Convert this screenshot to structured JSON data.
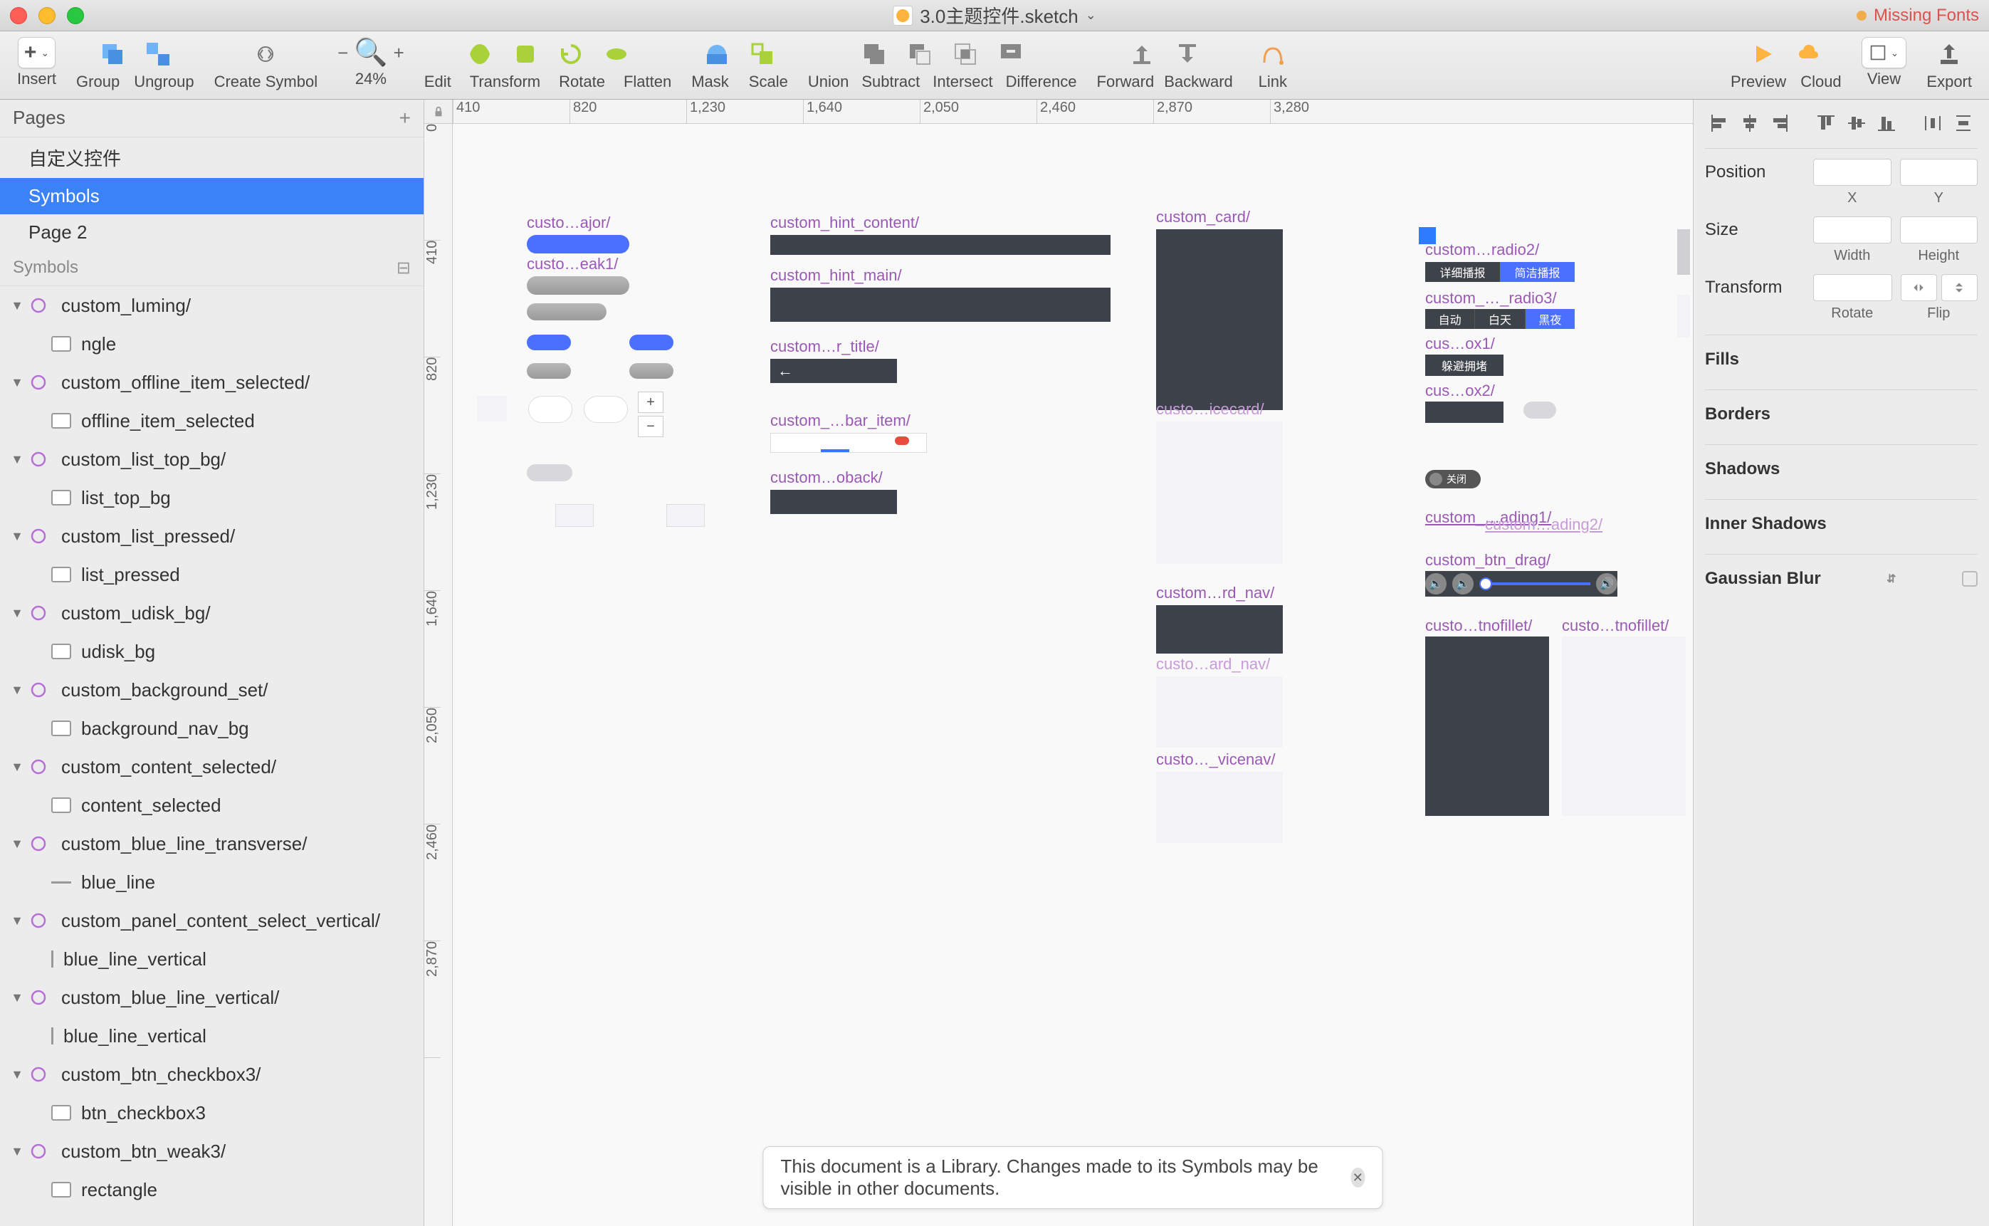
{
  "title": "3.0主题控件.sketch",
  "missing_fonts": "Missing Fonts",
  "toolbar": {
    "insert": "Insert",
    "group": "Group",
    "ungroup": "Ungroup",
    "create_symbol": "Create Symbol",
    "zoom": "24%",
    "edit": "Edit",
    "transform": "Transform",
    "rotate": "Rotate",
    "flatten": "Flatten",
    "mask": "Mask",
    "scale": "Scale",
    "union": "Union",
    "subtract": "Subtract",
    "intersect": "Intersect",
    "difference": "Difference",
    "forward": "Forward",
    "backward": "Backward",
    "link": "Link",
    "preview": "Preview",
    "cloud": "Cloud",
    "view": "View",
    "export": "Export"
  },
  "pages_header": "Pages",
  "pages": [
    "自定义控件",
    "Symbols",
    "Page 2"
  ],
  "symbols_header": "Symbols",
  "layers": [
    {
      "name": "custom_luming/",
      "type": "symbol",
      "level": 1,
      "expanded": true
    },
    {
      "name": "ngle",
      "type": "rect",
      "level": 2
    },
    {
      "name": "custom_offline_item_selected/",
      "type": "symbol",
      "level": 1,
      "expanded": true
    },
    {
      "name": "offline_item_selected",
      "type": "rect",
      "level": 2
    },
    {
      "name": "custom_list_top_bg/",
      "type": "symbol",
      "level": 1,
      "expanded": true
    },
    {
      "name": "list_top_bg",
      "type": "rect",
      "level": 2
    },
    {
      "name": "custom_list_pressed/",
      "type": "symbol",
      "level": 1,
      "expanded": true
    },
    {
      "name": "list_pressed",
      "type": "rect",
      "level": 2
    },
    {
      "name": "custom_udisk_bg/",
      "type": "symbol",
      "level": 1,
      "expanded": true
    },
    {
      "name": "udisk_bg",
      "type": "rect",
      "level": 2
    },
    {
      "name": "custom_background_set/",
      "type": "symbol",
      "level": 1,
      "expanded": true
    },
    {
      "name": "background_nav_bg",
      "type": "rect",
      "level": 2
    },
    {
      "name": "custom_content_selected/",
      "type": "symbol",
      "level": 1,
      "expanded": true
    },
    {
      "name": "content_selected",
      "type": "rect",
      "level": 2
    },
    {
      "name": "custom_blue_line_transverse/",
      "type": "symbol",
      "level": 1,
      "expanded": true
    },
    {
      "name": "blue_line",
      "type": "line",
      "level": 2
    },
    {
      "name": "custom_panel_content_select_vertical/",
      "type": "symbol",
      "level": 1,
      "expanded": true
    },
    {
      "name": "blue_line_vertical",
      "type": "vline",
      "level": 2
    },
    {
      "name": "custom_blue_line_vertical/",
      "type": "symbol",
      "level": 1,
      "expanded": true
    },
    {
      "name": "blue_line_vertical",
      "type": "vline",
      "level": 2
    },
    {
      "name": "custom_btn_checkbox3/",
      "type": "symbol",
      "level": 1,
      "expanded": true
    },
    {
      "name": "btn_checkbox3",
      "type": "rect",
      "level": 2
    },
    {
      "name": "custom_btn_weak3/",
      "type": "symbol",
      "level": 1,
      "expanded": true
    },
    {
      "name": "rectangle",
      "type": "rect",
      "level": 2
    }
  ],
  "ruler_h": [
    "410",
    "820",
    "1,230",
    "1,640",
    "2,050",
    "2,460",
    "2,870",
    "3,280"
  ],
  "ruler_v": [
    "0",
    "410",
    "820",
    "1,230",
    "1,640",
    "2,050",
    "2,460",
    "2,870"
  ],
  "artboards": {
    "major": "custo…ajor/",
    "eak1": "custo…eak1/",
    "hint_content": "custom_hint_content/",
    "hint_main": "custom_hint_main/",
    "r_title": "custom…r_title/",
    "bar_item": "custom_…bar_item/",
    "oback": "custom…oback/",
    "card": "custom_card/",
    "icecard": "custo…icecard/",
    "rd_nav": "custom…rd_nav/",
    "ard_nav": "custo…ard_nav/",
    "vicenav": "custo…_vicenav/",
    "radio2": "custom…radio2/",
    "radio3": "custom_…_radio3/",
    "ox1": "cus…ox1/",
    "ox2": "cus…ox2/",
    "ading1": "custom_…ading1/",
    "ading2": "custom…ading2/",
    "btn_drag": "custom_btn_drag/",
    "tnofillet1": "custo…tnofillet/",
    "tnofillet2": "custo…tnofillet/",
    "radio2_a": "详细播报",
    "radio2_b": "简洁播报",
    "radio3_a": "自动",
    "radio3_b": "白天",
    "radio3_c": "黑夜",
    "ox1_text": "躲避拥堵",
    "switch_text": "关闭"
  },
  "inspector": {
    "position": "Position",
    "x": "X",
    "y": "Y",
    "size": "Size",
    "width": "Width",
    "height": "Height",
    "transform": "Transform",
    "rotate": "Rotate",
    "flip": "Flip",
    "fills": "Fills",
    "borders": "Borders",
    "shadows": "Shadows",
    "inner_shadows": "Inner Shadows",
    "gaussian_blur": "Gaussian Blur"
  },
  "banner": "This document is a Library. Changes made to its Symbols may be visible in other documents."
}
